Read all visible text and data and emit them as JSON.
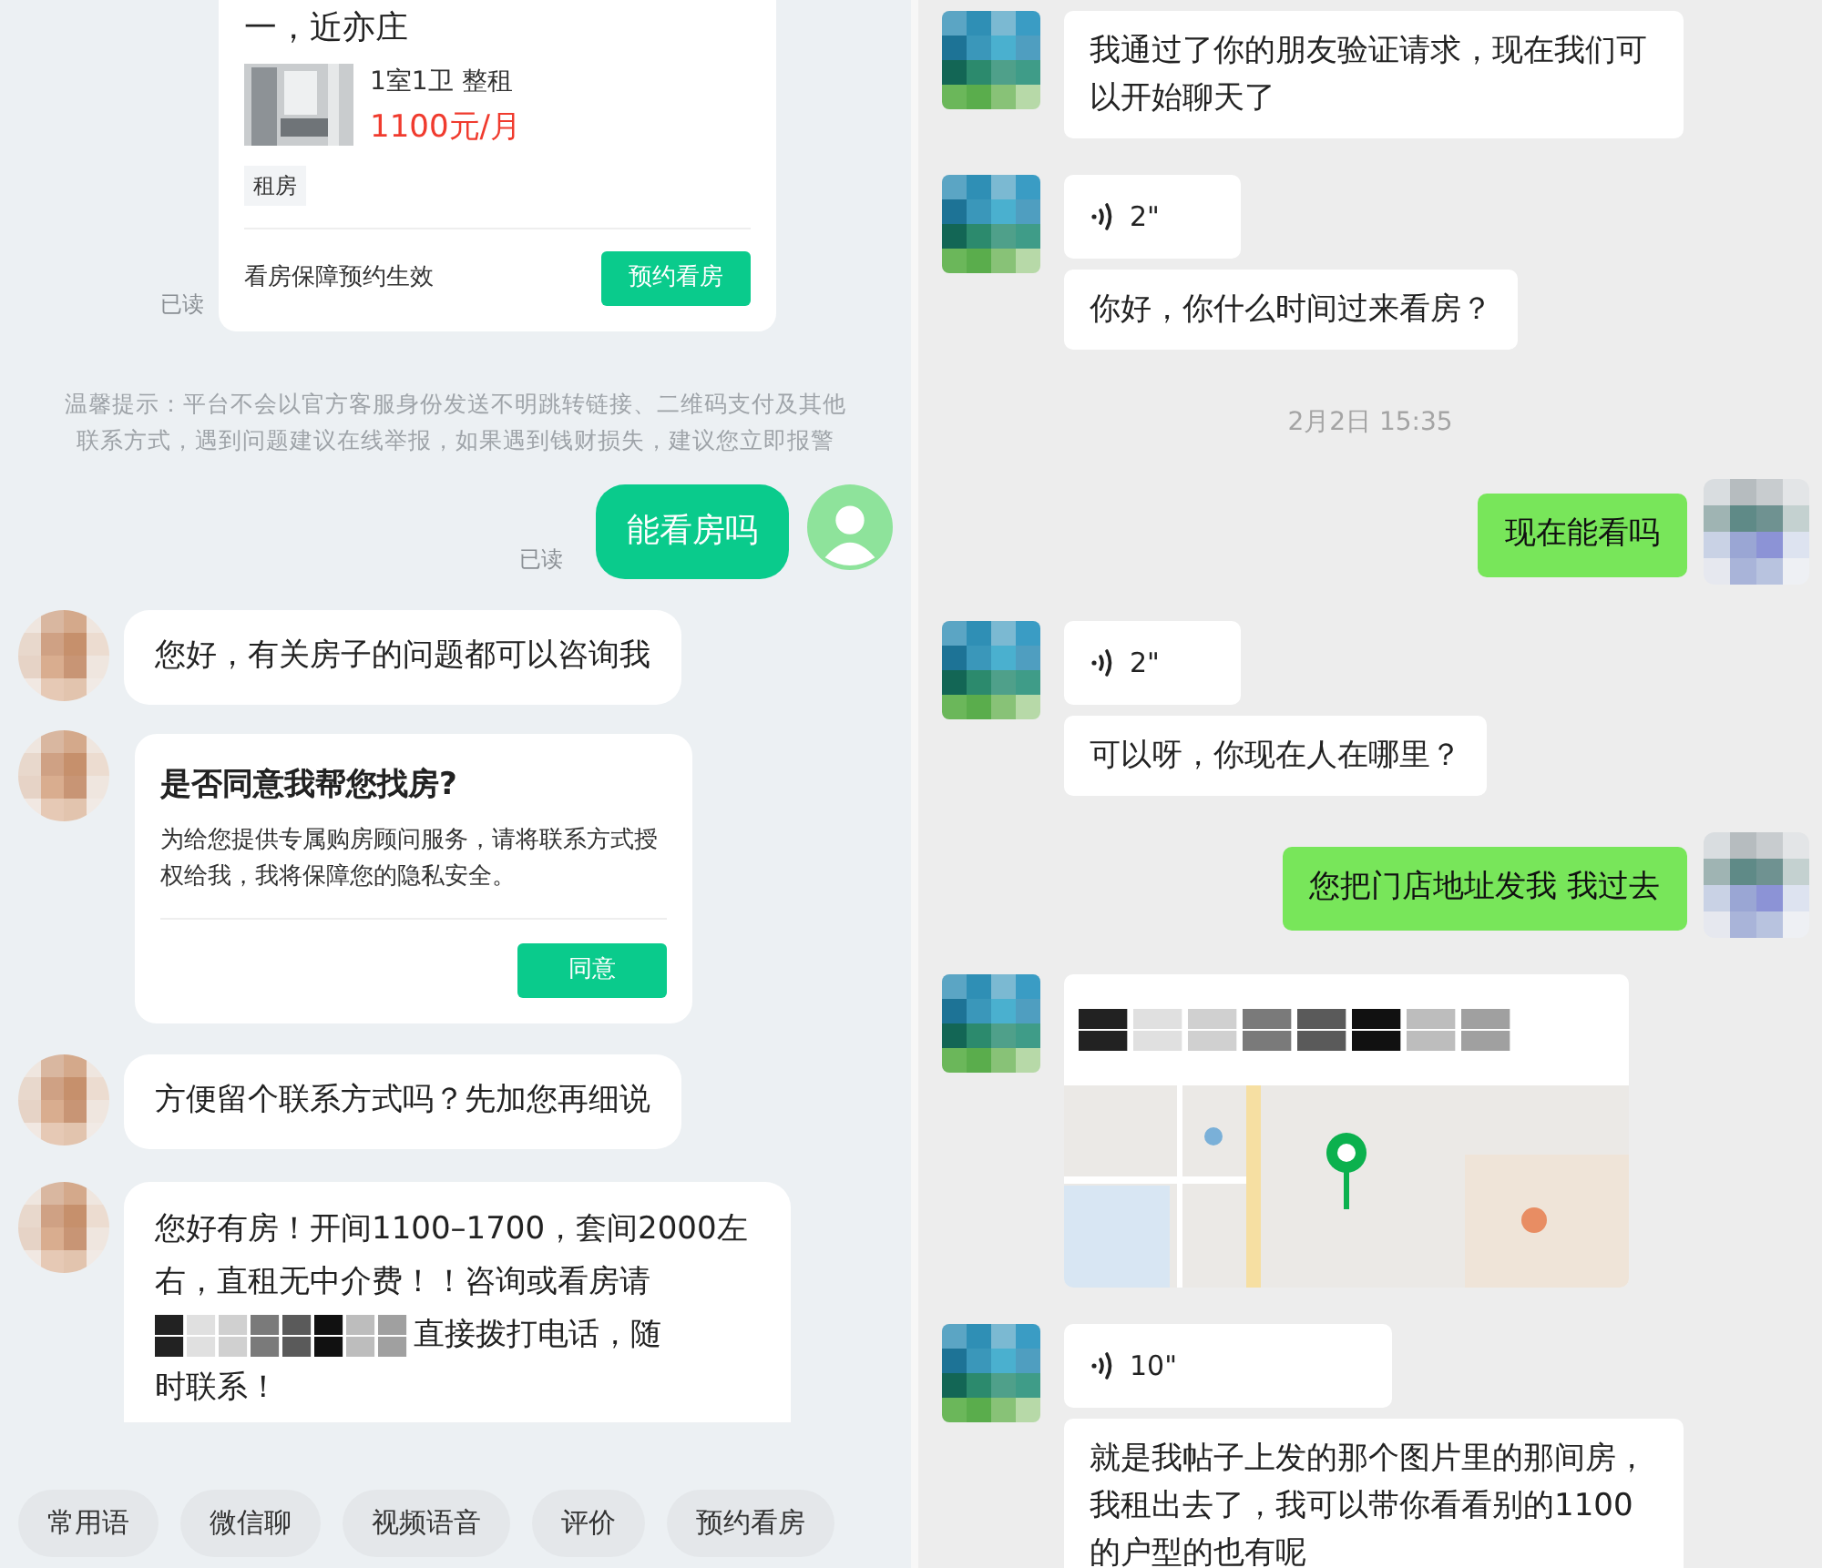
{
  "left_chat": {
    "listing_card": {
      "title": "一，近亦庄",
      "layout": "1室1卫 整租",
      "price": "1100元/月",
      "tag": "租房",
      "footer_text": "看房保障预约生效",
      "button": "预约看房",
      "read_label": "已读"
    },
    "notice": "温馨提示：平台不会以官方客服身份发送不明跳转链接、二维码支付及其他联系方式，遇到问题建议在线举报，如果遇到钱财损失，建议您立即报警",
    "messages": [
      {
        "kind": "sent",
        "text": "能看房吗",
        "read_label": "已读"
      },
      {
        "kind": "text",
        "text": "您好，有关房子的问题都可以咨询我"
      },
      {
        "kind": "consent_card",
        "title": "是否同意我帮您找房?",
        "body": "为给您提供专属购房顾问服务，请将联系方式授权给我，我将保障您的隐私安全。",
        "button": "同意"
      },
      {
        "kind": "text",
        "text": "方便留个联系方式吗？先加您再细说"
      },
      {
        "kind": "redacted_text",
        "before": "您好有房！开间1100–1700，套间2000左右，直租无中介费！！咨询或看房请",
        "after_lines": [
          "直接拨打电话，随",
          "时联系！"
        ]
      }
    ],
    "quick_replies": [
      "常用语",
      "微信聊",
      "视频语音",
      "评价",
      "预约看房"
    ]
  },
  "right_chat": {
    "messages": [
      {
        "kind": "received",
        "bubbles": [
          {
            "kind": "text",
            "text": "我通过了你的朋友验证请求，现在我们可以开始聊天了"
          }
        ]
      },
      {
        "kind": "received",
        "bubbles": [
          {
            "kind": "voice",
            "duration": "2\""
          },
          {
            "kind": "text",
            "text": "你好，你什么时间过来看房？"
          }
        ]
      },
      {
        "kind": "time",
        "text": "2月2日 15:35"
      },
      {
        "kind": "sent",
        "text": "现在能看吗"
      },
      {
        "kind": "received",
        "bubbles": [
          {
            "kind": "voice",
            "duration": "2\""
          },
          {
            "kind": "text",
            "text": "可以呀，你现在人在哪里？"
          }
        ]
      },
      {
        "kind": "sent",
        "text": "您把门店地址发我 我过去"
      },
      {
        "kind": "received",
        "bubbles": [
          {
            "kind": "location"
          }
        ]
      },
      {
        "kind": "received",
        "bubbles": [
          {
            "kind": "voice",
            "duration": "10\""
          },
          {
            "kind": "text",
            "text": "就是我帖子上发的那个图片里的那间房，我租出去了，我可以带你看看别的1100的户型的也有呢"
          }
        ]
      }
    ]
  }
}
